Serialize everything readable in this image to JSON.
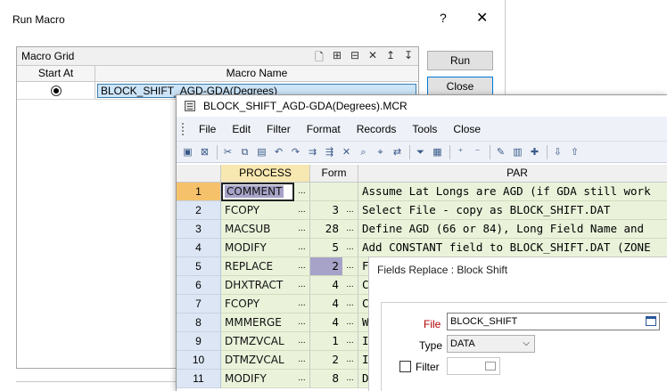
{
  "run_macro": {
    "title": "Run Macro",
    "help_label": "?",
    "close_label": "✕",
    "panel_title": "Macro Grid",
    "tool_icons": [
      "new-icon",
      "tree-icon",
      "insert-icon",
      "delete-icon",
      "move-up-icon",
      "move-down-icon"
    ],
    "columns": {
      "start_at": "Start At",
      "macro_name": "Macro Name"
    },
    "row": {
      "macro_name": "BLOCK_SHIFT_AGD-GDA(Degrees)"
    },
    "run_button": "Run",
    "close_button": "Close"
  },
  "mcr": {
    "title": "BLOCK_SHIFT_AGD-GDA(Degrees).MCR",
    "menu": [
      "File",
      "Edit",
      "Filter",
      "Format",
      "Records",
      "Tools",
      "Close"
    ],
    "grid_headers": {
      "process": "PROCESS",
      "form": "Form",
      "par": "PAR"
    },
    "rows": [
      {
        "num": "1",
        "process": "COMMENT",
        "form": "",
        "par": "Assume Lat Longs are AGD (if GDA still work"
      },
      {
        "num": "2",
        "process": "FCOPY",
        "form": "3",
        "par": "Select File - copy as BLOCK_SHIFT.DAT"
      },
      {
        "num": "3",
        "process": "MACSUB",
        "form": "28",
        "par": "Define AGD (66 or 84), Long Field Name and"
      },
      {
        "num": "4",
        "process": "MODIFY",
        "form": "5",
        "par": "Add CONSTANT field to BLOCK_SHIFT.DAT (ZONE"
      },
      {
        "num": "5",
        "process": "REPLACE",
        "form": "2",
        "par": "F"
      },
      {
        "num": "6",
        "process": "DHXTRACT",
        "form": "4",
        "par": "C"
      },
      {
        "num": "7",
        "process": "FCOPY",
        "form": "4",
        "par": "C"
      },
      {
        "num": "8",
        "process": "MMMERGE",
        "form": "4",
        "par": "W"
      },
      {
        "num": "9",
        "process": "DTMZVCAL",
        "form": "1",
        "par": "I"
      },
      {
        "num": "10",
        "process": "DTMZVCAL",
        "form": "2",
        "par": "I"
      },
      {
        "num": "11",
        "process": "MODIFY",
        "form": "8",
        "par": "D"
      }
    ],
    "dots": "..."
  },
  "fields_replace": {
    "title": "Fields Replace : Block Shift",
    "file_label": "File",
    "file_value": "BLOCK_SHIFT",
    "type_label": "Type",
    "type_value": "DATA",
    "filter_label": "Filter"
  }
}
